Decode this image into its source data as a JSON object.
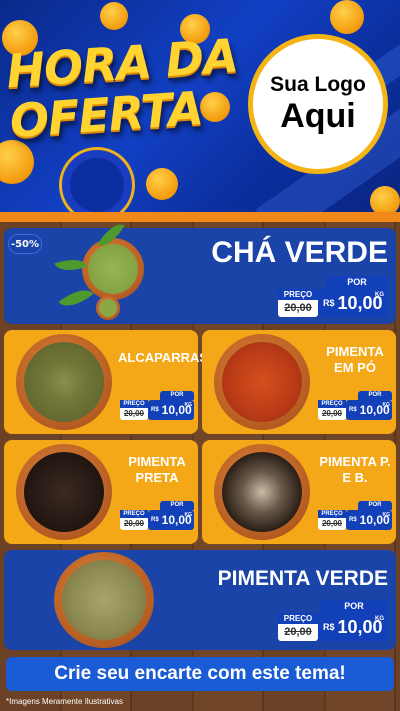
{
  "hero": {
    "title_line1": "HORA DA",
    "title_line2": "OFERTA",
    "logo_line1": "Sua Logo",
    "logo_line2": "Aqui"
  },
  "discount_badge": "-50%",
  "price_labels": {
    "por": "POR",
    "preco": "PREÇO",
    "currency": "R$",
    "unit": "KG"
  },
  "products": [
    {
      "name": "CHÁ VERDE",
      "old_price": "20,00",
      "price": "10,00"
    },
    {
      "name": "ALCAPARRAS",
      "old_price": "20,00",
      "price": "10,00"
    },
    {
      "name": "PIMENTA EM PÓ",
      "old_price": "20,00",
      "price": "10,00"
    },
    {
      "name": "PIMENTA PRETA",
      "old_price": "20,00",
      "price": "10,00"
    },
    {
      "name": "PIMENTA P. E B.",
      "old_price": "20,00",
      "price": "10,00"
    },
    {
      "name": "PIMENTA VERDE",
      "old_price": "20,00",
      "price": "10,00"
    }
  ],
  "cta": "Crie seu encarte com este tema!",
  "footnote": "*Imagens Meramente Ilustrativas",
  "colors": {
    "blue": "#1a44a8",
    "yellow": "#f5a817",
    "orange": "#f0881a",
    "title_yellow": "#ffd330"
  }
}
